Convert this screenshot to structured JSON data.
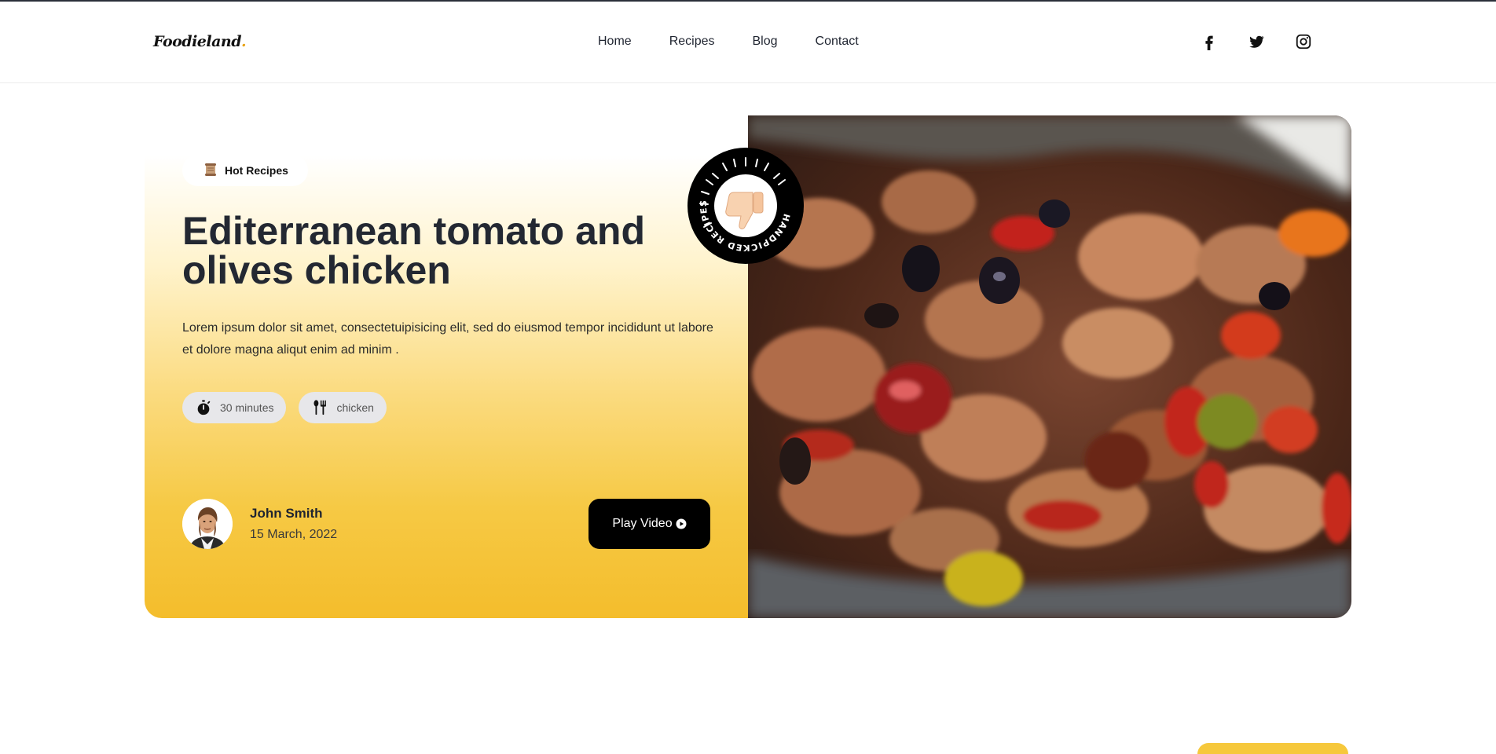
{
  "brand": {
    "name": "Foodieland",
    "dot": ".",
    "accent": "#e8a317"
  },
  "nav": {
    "items": [
      "Home",
      "Recipes",
      "Blog",
      "Contact"
    ],
    "socials": [
      "facebook-icon",
      "twitter-icon",
      "instagram-icon"
    ]
  },
  "hero": {
    "tag": {
      "label": "Hot Recipes",
      "icon": "scroll-icon"
    },
    "title": "Editerranean tomato and olives chicken",
    "description": "Lorem ipsum dolor sit amet, consectetuipisicing elit, sed do eiusmod tempor incididunt ut labore et dolore magna aliqut enim ad minim .",
    "chips": [
      {
        "label": "30 minutes",
        "icon": "timer-icon"
      },
      {
        "label": "chicken",
        "icon": "fork-knife-icon"
      }
    ],
    "author": {
      "name": "John Smith",
      "date": "15 March, 2022"
    },
    "play_button": {
      "label": "Play Video",
      "icon": "play-circle-icon"
    },
    "badge": {
      "text": "HANDPICKED RECIPES",
      "icon": "thumbs-up-icon"
    },
    "gradient_colors": [
      "#ffffff",
      "#f4bd2c"
    ]
  }
}
